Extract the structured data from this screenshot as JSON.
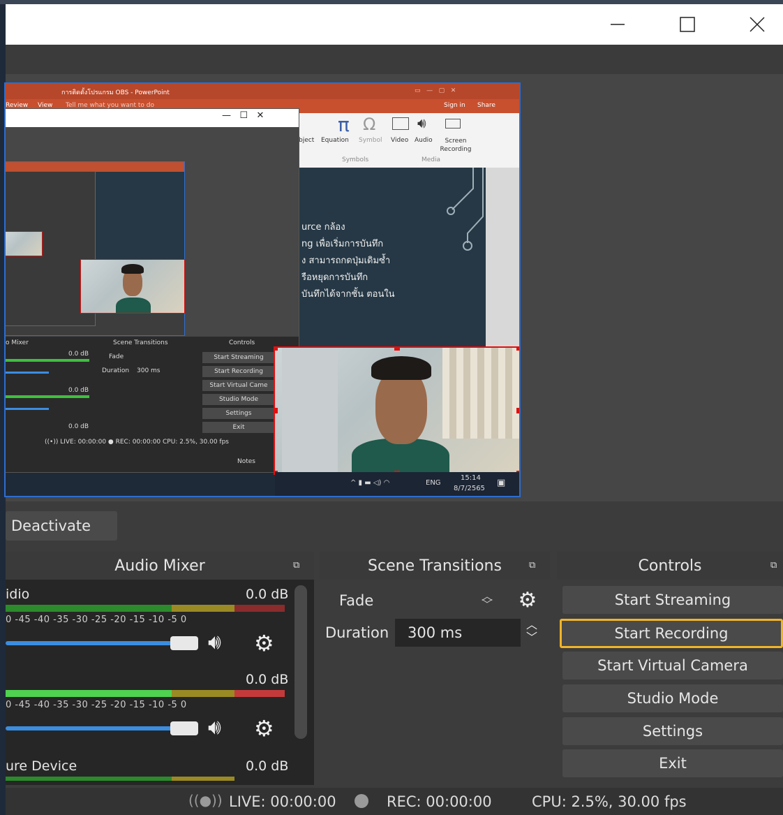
{
  "window": {
    "controls": {
      "minimize": "—",
      "maximize": "☐",
      "close": "✕"
    }
  },
  "capture": {
    "ppt_title": "การติดตั้งโปรแกรม OBS - PowerPoint",
    "ppt_tabs": [
      "Review",
      "View",
      "Tell me what you want to do"
    ],
    "ppt_right": [
      "Sign in",
      "Share"
    ],
    "ribbon": {
      "items": [
        "bject",
        "Equation",
        "Symbol",
        "Video",
        "Audio",
        "Screen Recording"
      ],
      "groups": [
        "Symbols",
        "Media"
      ]
    },
    "slide_lines": [
      "urce กล้อง",
      "ng เพื่อเริ่มการบันทึก",
      "ง สามารถกดปุ่มเดิมซ้ำ",
      "รือหยุดการบันทึก",
      "บันทึกได้จากชั้น ตอนใน"
    ],
    "inner_obs": {
      "docks": [
        "o Mixer",
        "Scene Transitions",
        "Controls"
      ],
      "transition": "Fade",
      "duration_label": "Duration",
      "duration": "300 ms",
      "controls": [
        "Start Streaming",
        "Start Recording",
        "Start Virtual Came",
        "Studio Mode",
        "Settings",
        "Exit"
      ],
      "db": [
        "0.0 dB",
        "0.0 dB",
        "0.0 dB"
      ],
      "status": "((•)) LIVE: 00:00:00    ● REC: 00:00:00      CPU: 2.5%, 30.00 fps",
      "notes": "Notes"
    },
    "taskbar": {
      "lang": "ENG",
      "time": "15:14",
      "date": "8/7/2565"
    }
  },
  "deactivate_label": "Deactivate",
  "audio_mixer": {
    "title": "Audio Mixer",
    "channels": [
      {
        "label": "idio",
        "db": "0.0 dB"
      },
      {
        "label": "",
        "db": "0.0 dB"
      },
      {
        "label": "ure Device",
        "db": "0.0 dB"
      }
    ],
    "ticks": "0  -45  -40  -35  -30  -25  -20  -15  -10   -5    0"
  },
  "scene_transitions": {
    "title": "Scene Transitions",
    "transition": "Fade",
    "duration_label": "Duration",
    "duration_value": "300 ms"
  },
  "controls": {
    "title": "Controls",
    "start_streaming": "Start Streaming",
    "start_recording": "Start Recording",
    "start_virtual_camera": "Start Virtual Camera",
    "studio_mode": "Studio Mode",
    "settings": "Settings",
    "exit": "Exit",
    "highlight_color": "#f0b429"
  },
  "status": {
    "live": "LIVE: 00:00:00",
    "rec": "REC: 00:00:00",
    "cpu": "CPU: 2.5%, 30.00 fps"
  },
  "colors": {
    "meter_green": "#3fbf3f",
    "meter_yellow": "#c9b22c",
    "meter_red": "#d33a3a",
    "slider": "#3b8de0"
  }
}
